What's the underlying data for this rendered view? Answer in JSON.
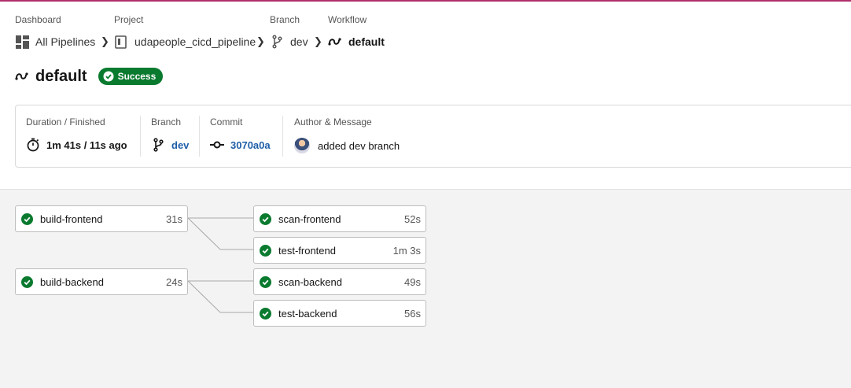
{
  "breadcrumb": {
    "dashboard": {
      "label": "Dashboard",
      "value": "All Pipelines",
      "icon": "dashboard-icon"
    },
    "project": {
      "label": "Project",
      "value": "udapeople_cicd_pipeline",
      "icon": "repo-icon"
    },
    "branch": {
      "label": "Branch",
      "value": "dev",
      "icon": "branch-icon"
    },
    "workflow": {
      "label": "Workflow",
      "value": "default",
      "icon": "workflow-icon"
    }
  },
  "workflow": {
    "title": "default",
    "status": "Success",
    "status_color": "#0a7a2f"
  },
  "summary": {
    "duration": {
      "label": "Duration / Finished",
      "value": "1m 41s / 11s ago",
      "icon": "stopwatch-icon"
    },
    "branch": {
      "label": "Branch",
      "value": "dev",
      "icon": "branch-icon"
    },
    "commit": {
      "label": "Commit",
      "value": "3070a0a",
      "icon": "commit-icon"
    },
    "author": {
      "label": "Author & Message",
      "value": "added dev branch",
      "icon": "avatar"
    }
  },
  "jobs": {
    "build_frontend": {
      "name": "build-frontend",
      "duration": "31s",
      "status": "success"
    },
    "scan_frontend": {
      "name": "scan-frontend",
      "duration": "52s",
      "status": "success"
    },
    "test_frontend": {
      "name": "test-frontend",
      "duration": "1m 3s",
      "status": "success"
    },
    "build_backend": {
      "name": "build-backend",
      "duration": "24s",
      "status": "success"
    },
    "scan_backend": {
      "name": "scan-backend",
      "duration": "49s",
      "status": "success"
    },
    "test_backend": {
      "name": "test-backend",
      "duration": "56s",
      "status": "success"
    }
  },
  "colors": {
    "accent": "#b0306a",
    "success": "#0a7a2f",
    "link": "#1f5ea8"
  }
}
